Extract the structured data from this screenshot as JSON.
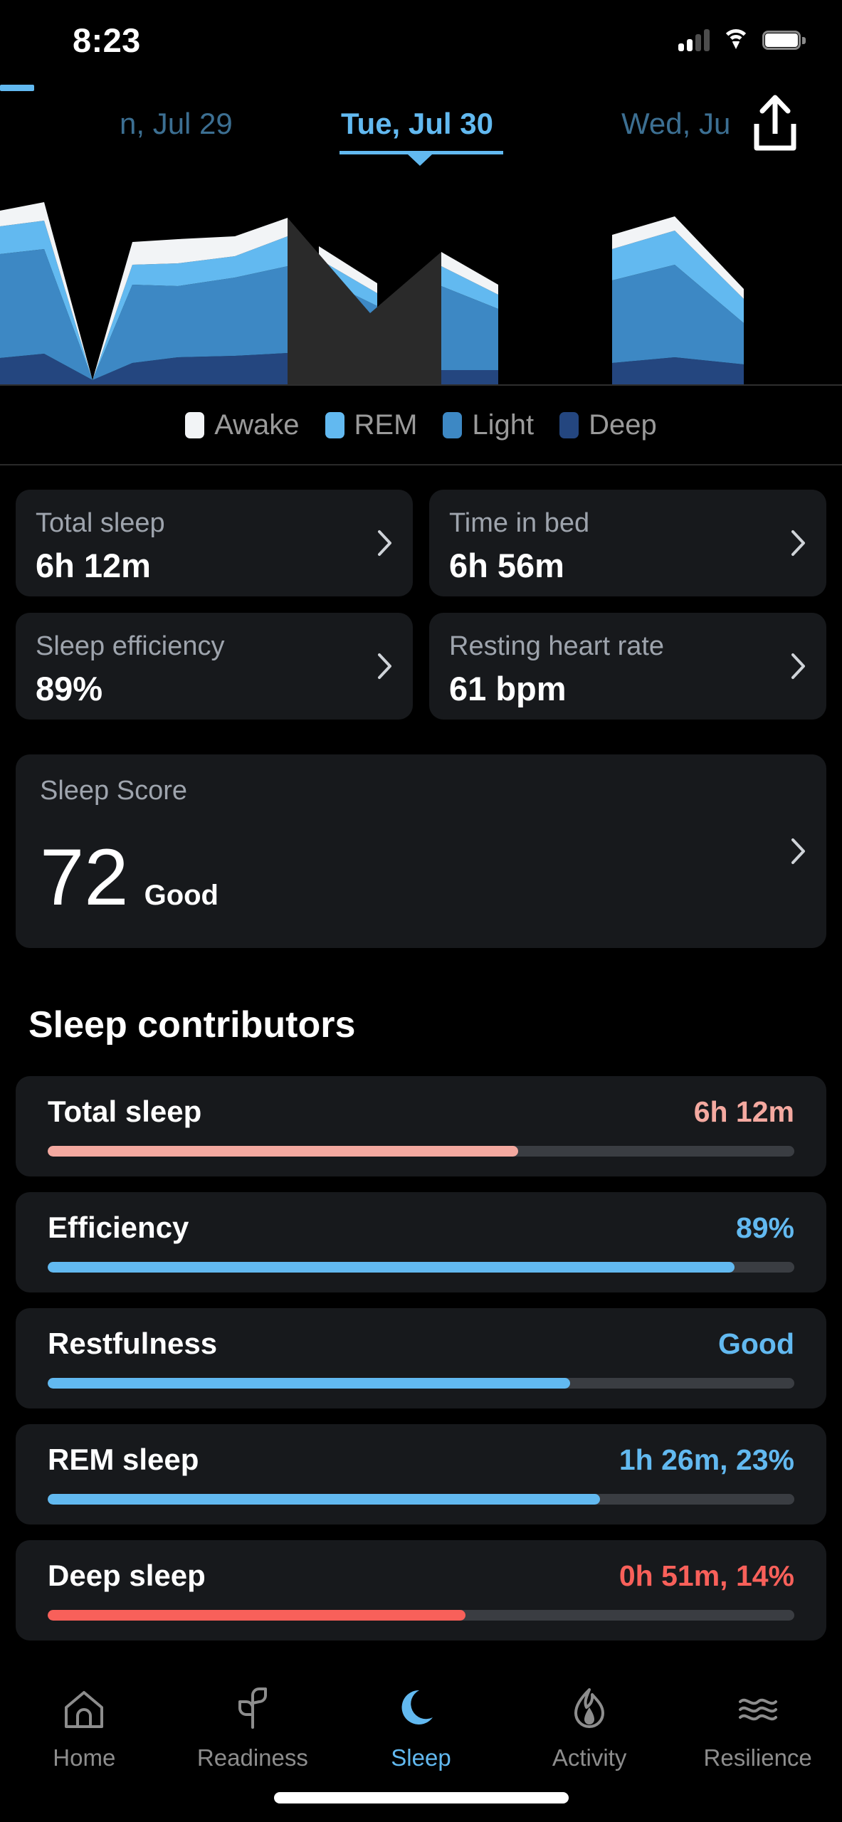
{
  "status_bar": {
    "time": "8:23",
    "signal_icon": "cellular-signal-icon",
    "wifi_icon": "wifi-icon",
    "battery_icon": "battery-icon"
  },
  "date_nav": {
    "prev_label": "n, Jul 29",
    "current_label": "Tue, Jul 30",
    "next_label": "Wed, Ju",
    "share_icon": "share-icon",
    "accent": "#62b9f0",
    "inactive_color": "#3c6f92"
  },
  "chart_data": {
    "type": "area",
    "title": "Sleep stages hypnogram",
    "stacked": true,
    "grid": false,
    "legend_position": "bottom",
    "series": [
      {
        "name": "Deep",
        "color": "#24467f"
      },
      {
        "name": "Light",
        "color": "#3d88c4"
      },
      {
        "name": "REM",
        "color": "#62b9f0"
      },
      {
        "name": "Awake",
        "color": "#f2f4f6"
      }
    ],
    "legend": [
      {
        "label": "Awake",
        "color": "#f2f4f6"
      },
      {
        "label": "REM",
        "color": "#62b9f0"
      },
      {
        "label": "Light",
        "color": "#3d88c4"
      },
      {
        "label": "Deep",
        "color": "#24467f"
      }
    ],
    "selection_overlay_color": "#2a2a2a",
    "notes": "Stacked sleep-stage area chart across the night; a dark overlay masks a mid-night segment."
  },
  "metrics": [
    {
      "label": "Total sleep",
      "value": "6h 12m",
      "chevron": "chevron-right-icon"
    },
    {
      "label": "Time in bed",
      "value": "6h 56m",
      "chevron": "chevron-right-icon"
    },
    {
      "label": "Sleep efficiency",
      "value": "89%",
      "chevron": "chevron-right-icon"
    },
    {
      "label": "Resting heart rate",
      "value": "61 bpm",
      "chevron": "chevron-right-icon"
    }
  ],
  "sleep_score": {
    "label": "Sleep Score",
    "value": "72",
    "state": "Good",
    "chevron": "chevron-right-icon"
  },
  "contributors": {
    "title": "Sleep contributors",
    "items": [
      {
        "name": "Total sleep",
        "value": "6h 12m",
        "percent": 63,
        "color": "#f4a9a0"
      },
      {
        "name": "Efficiency",
        "value": "89%",
        "percent": 92,
        "color": "#62b9f0"
      },
      {
        "name": "Restfulness",
        "value": "Good",
        "percent": 70,
        "color": "#62b9f0"
      },
      {
        "name": "REM sleep",
        "value": "1h 26m, 23%",
        "percent": 74,
        "color": "#62b9f0"
      },
      {
        "name": "Deep sleep",
        "value": "0h 51m, 14%",
        "percent": 56,
        "color": "#f8605a"
      }
    ]
  },
  "tabbar": {
    "items": [
      {
        "label": "Home",
        "icon": "home-icon",
        "active": false
      },
      {
        "label": "Readiness",
        "icon": "sprout-icon",
        "active": false
      },
      {
        "label": "Sleep",
        "icon": "moon-icon",
        "active": true
      },
      {
        "label": "Activity",
        "icon": "flame-icon",
        "active": false
      },
      {
        "label": "Resilience",
        "icon": "waves-icon",
        "active": false
      }
    ],
    "active_color": "#62b9f0",
    "inactive_color": "#8d8d8d"
  }
}
